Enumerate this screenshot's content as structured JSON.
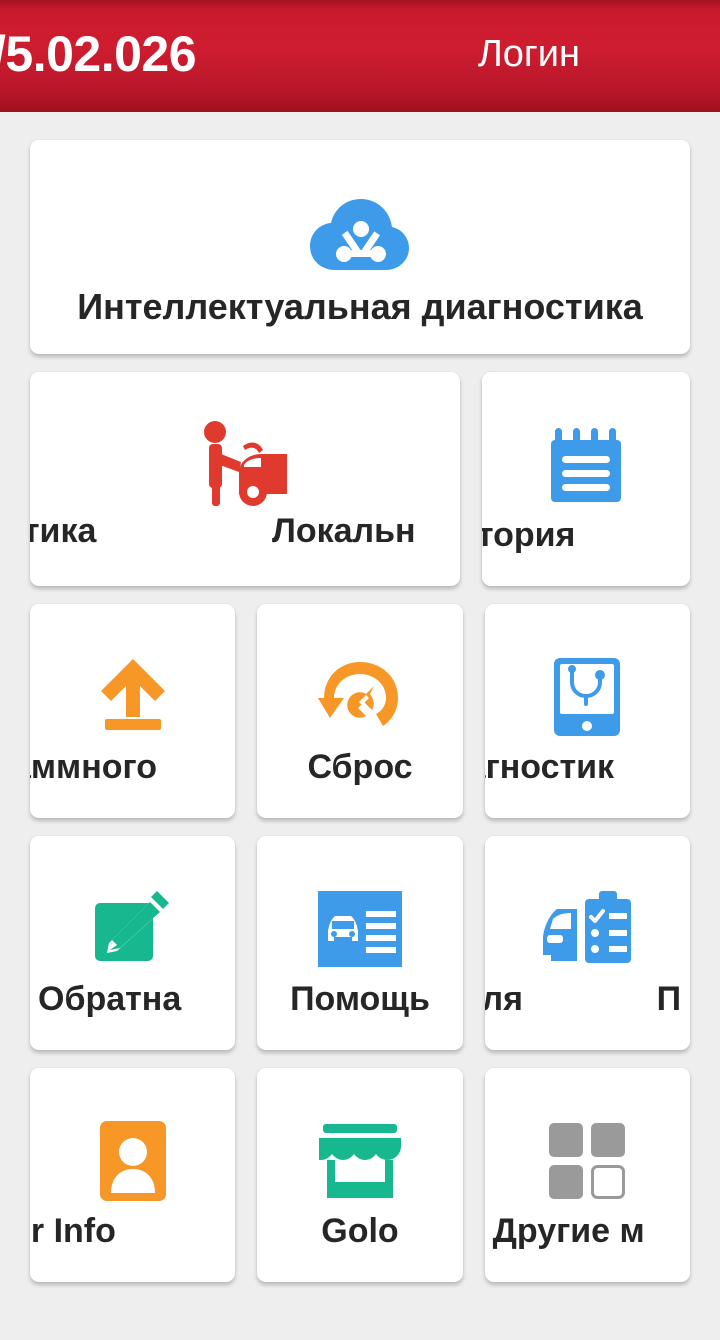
{
  "header": {
    "title": "/5.02.026",
    "login_label": "Логин",
    "bg_color": "#c81a2c",
    "text_color": "#ffffff"
  },
  "colors": {
    "page_bg": "#eeeeee",
    "card_bg": "#ffffff",
    "label": "#262626",
    "blue": "#3d9be9",
    "red": "#e03a2f",
    "orange": "#f79727",
    "green": "#17b890",
    "gray": "#9a9a9a"
  },
  "cards": {
    "banner": {
      "label": "Интеллектуальная диагностика",
      "icon": "cloud-network-icon",
      "icon_color": "#3d9be9"
    },
    "row2": {
      "wide": {
        "label_left": "стика",
        "label_right": "Локальн",
        "icon": "mechanic-car-icon",
        "icon_color": "#e03a2f"
      },
      "history": {
        "label": "стория",
        "icon": "notepad-icon",
        "icon_color": "#3d9be9"
      }
    },
    "row3": [
      {
        "label": "аммного",
        "icon": "upload-arrow-icon",
        "icon_color": "#f79727"
      },
      {
        "label": "Сброс",
        "icon": "reset-wrench-icon",
        "icon_color": "#f79727"
      },
      {
        "label": "агностик",
        "icon": "tablet-stethoscope-icon",
        "icon_color": "#3d9be9"
      }
    ],
    "row4": [
      {
        "label": "Обратна",
        "icon": "edit-pencil-icon",
        "icon_color": "#17b890"
      },
      {
        "label": "Помощь",
        "icon": "car-document-icon",
        "icon_color": "#3d9be9"
      },
      {
        "label_left": "иля",
        "label_right": "П",
        "icon": "car-checklist-icon",
        "icon_color": "#3d9be9"
      }
    ],
    "row5": [
      {
        "label": "er Info",
        "icon": "user-card-icon",
        "icon_color": "#f79727"
      },
      {
        "label": "Golo",
        "icon": "store-icon",
        "icon_color": "#17b890"
      },
      {
        "label": "Другие м",
        "icon": "grid-squares-icon",
        "icon_color": "#9a9a9a"
      }
    ]
  }
}
